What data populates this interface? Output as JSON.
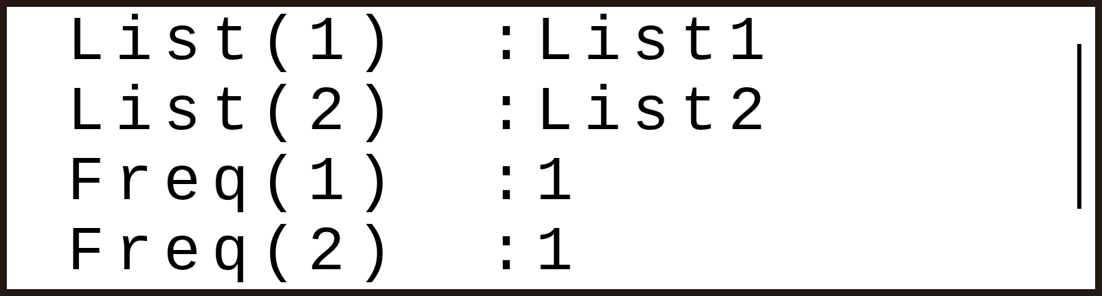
{
  "rows": [
    {
      "label": "List(1)",
      "value": ":List1"
    },
    {
      "label": "List(2)",
      "value": ":List2"
    },
    {
      "label": "Freq(1)",
      "value": ":1"
    },
    {
      "label": "Freq(2)",
      "value": ":1"
    }
  ]
}
